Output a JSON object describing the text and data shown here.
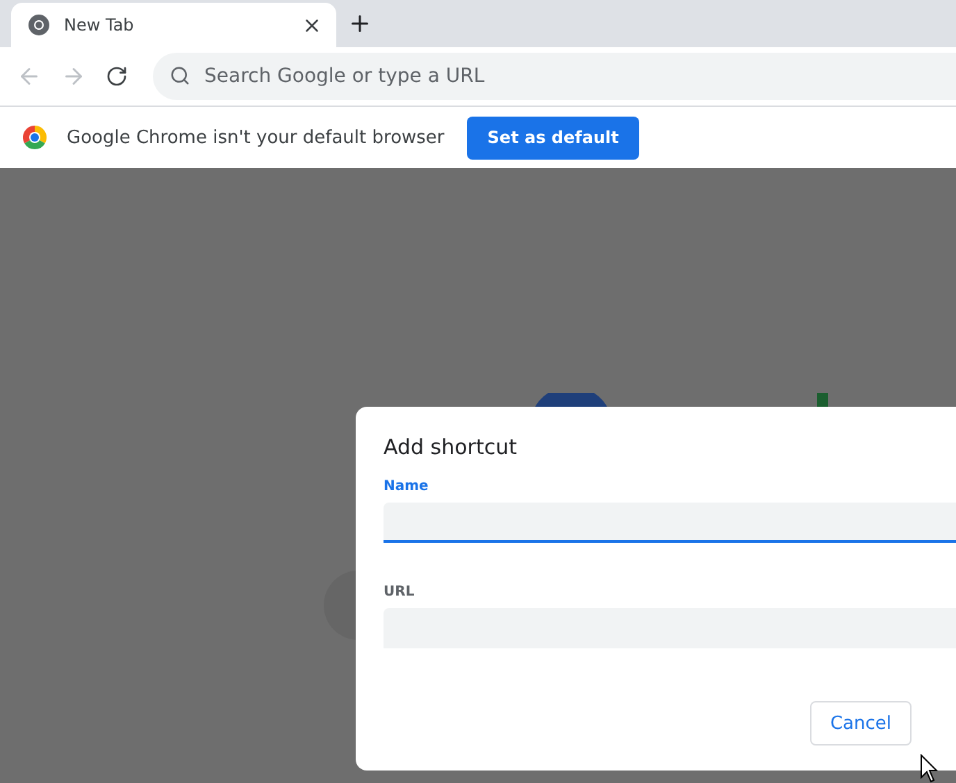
{
  "tabs": [
    {
      "title": "New Tab",
      "selected": true
    }
  ],
  "omnibox": {
    "placeholder": "Search Google or type a URL"
  },
  "infobar": {
    "message": "Google Chrome isn't your default browser",
    "button": "Set as default"
  },
  "dialog": {
    "title": "Add shortcut",
    "fields": [
      {
        "label": "Name",
        "focused": true
      },
      {
        "label": "URL",
        "focused": false
      }
    ],
    "buttons": [
      "Cancel"
    ]
  }
}
